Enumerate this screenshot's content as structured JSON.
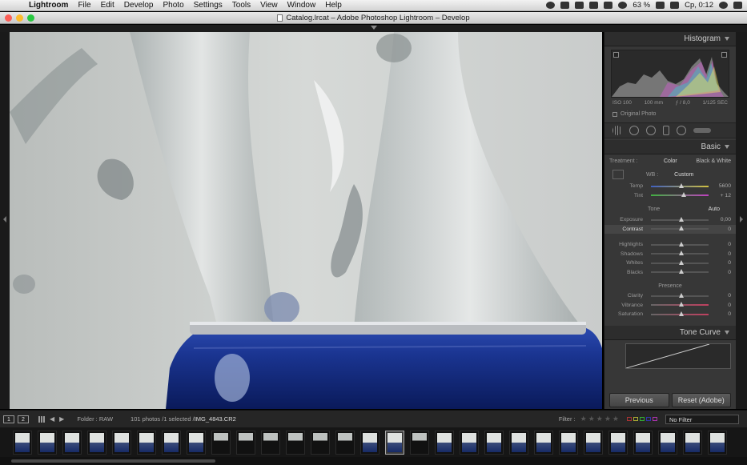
{
  "menubar": {
    "app": "Lightroom",
    "items": [
      "File",
      "Edit",
      "Develop",
      "Photo",
      "Settings",
      "Tools",
      "View",
      "Window",
      "Help"
    ],
    "battery": "63 %",
    "clock": "Ср, 0:12"
  },
  "window": {
    "title": "Catalog.lrcat – Adobe Photoshop Lightroom – Develop"
  },
  "panel": {
    "histogram_title": "Histogram",
    "camera_info": [
      "ISO 100",
      "100 mm",
      "ƒ / 8,0",
      "1/125 SEC"
    ],
    "original_photo": "Original Photo",
    "basic_title": "Basic",
    "treatment_label": "Treatment :",
    "treatment_color": "Color",
    "treatment_bw": "Black & White",
    "wb_label": "WB :",
    "wb_value": "Custom",
    "temp": {
      "label": "Temp",
      "value": "5600",
      "pos": 0.48
    },
    "tint": {
      "label": "Tint",
      "value": "+ 12",
      "pos": 0.53
    },
    "tone_label": "Tone",
    "auto_label": "Auto",
    "exposure": {
      "label": "Exposure",
      "value": "0,00",
      "pos": 0.5
    },
    "contrast": {
      "label": "Contrast",
      "value": "0",
      "pos": 0.5
    },
    "highlights": {
      "label": "Highlights",
      "value": "0",
      "pos": 0.5
    },
    "shadows": {
      "label": "Shadows",
      "value": "0",
      "pos": 0.5
    },
    "whites": {
      "label": "Whites",
      "value": "0",
      "pos": 0.5
    },
    "blacks": {
      "label": "Blacks",
      "value": "0",
      "pos": 0.5
    },
    "presence_label": "Presence",
    "clarity": {
      "label": "Clarity",
      "value": "0",
      "pos": 0.5
    },
    "vibrance": {
      "label": "Vibrance",
      "value": "0",
      "pos": 0.5
    },
    "saturation": {
      "label": "Saturation",
      "value": "0",
      "pos": 0.5
    },
    "tonecurve_title": "Tone Curve",
    "previous_btn": "Previous",
    "reset_btn": "Reset (Adobe)"
  },
  "toolbar": {
    "screen1": "1",
    "screen2": "2",
    "folder": "Folder : RAW",
    "count": "101 photos /1 selected /",
    "current_file": "IMG_4843.CR2",
    "filter_label": "Filter :",
    "filter_value": "No Filter"
  },
  "filmstrip": {
    "count": 29,
    "selected_index": 15
  },
  "colors": {
    "panel_bg": "#373737",
    "can_blue": "#1a3a9a"
  }
}
